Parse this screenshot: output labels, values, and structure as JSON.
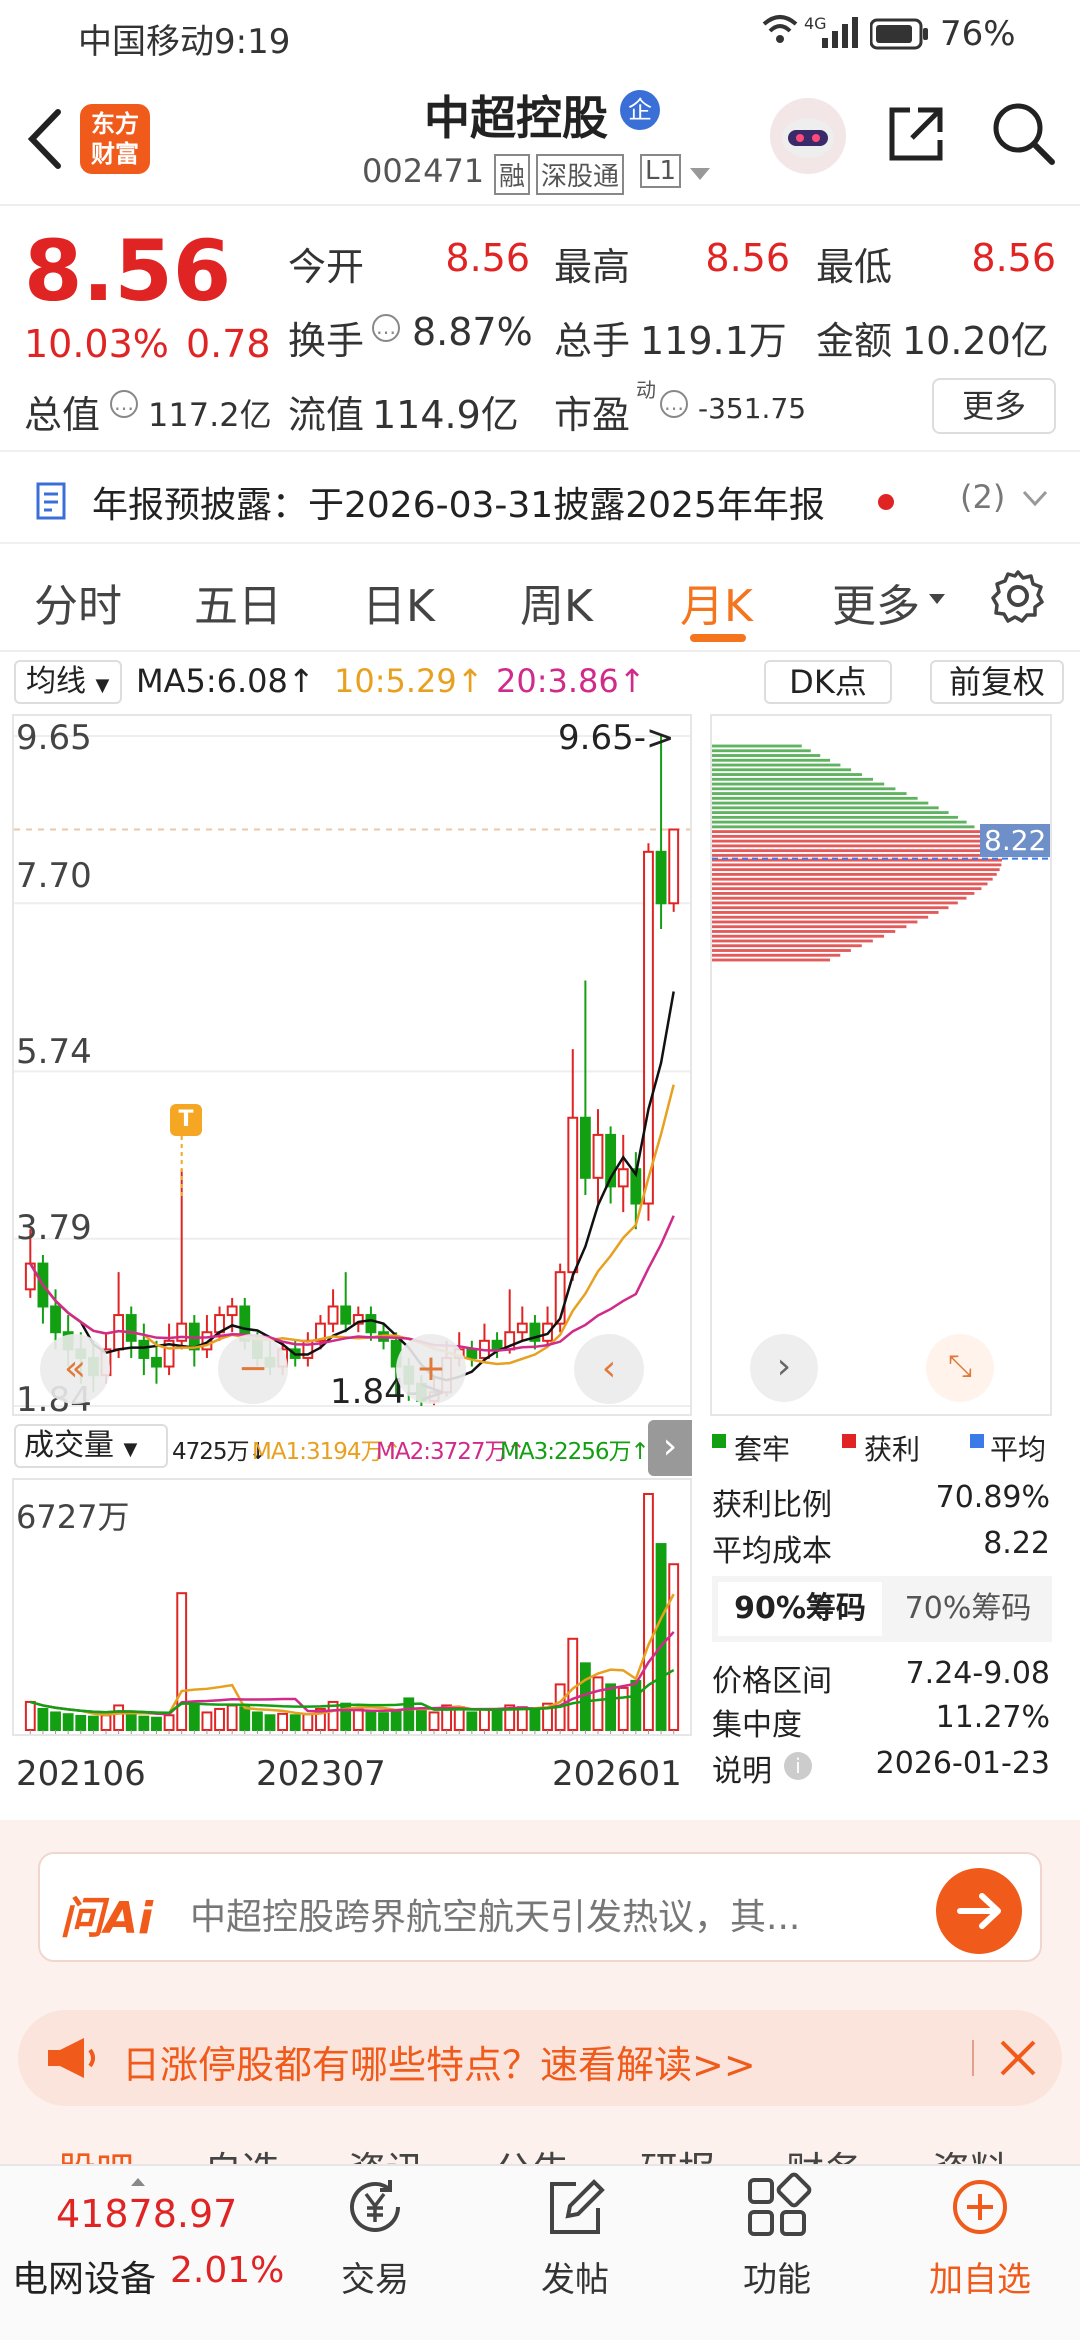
{
  "status_bar": {
    "carrier_time": "中国移动9:19",
    "signal": "4G",
    "battery": "76%"
  },
  "header": {
    "logo": "东方\n财富",
    "stock_name": "中超控股",
    "badge": "企",
    "code": "002471",
    "tags": [
      "融",
      "深股通",
      "L1"
    ]
  },
  "quote": {
    "price": "8.56",
    "change_pct": "10.03%",
    "change": "0.78",
    "open_label": "今开",
    "open": "8.56",
    "high_label": "最高",
    "high": "8.56",
    "low_label": "最低",
    "low": "8.56",
    "turnover_label": "换手",
    "turnover": "8.87%",
    "volume_label": "总手",
    "volume": "119.1万",
    "amount_label": "金额",
    "amount": "10.20亿",
    "mktcap_label": "总值",
    "mktcap": "117.2亿",
    "float_label": "流值",
    "float": "114.9亿",
    "pe_label": "市盈",
    "pe_sup": "动",
    "pe": "-351.75",
    "more_label": "更多"
  },
  "notice": {
    "text": "年报预披露：于2026-03-31披露2025年年报",
    "count": "(2)"
  },
  "tabs": [
    "分时",
    "五日",
    "日K",
    "周K",
    "月K",
    "更多"
  ],
  "active_tab": "月K",
  "ma_bar": {
    "selector": "均线",
    "ma5": "MA5:6.08",
    "ma10": "10:5.29",
    "ma20": "20:3.86",
    "dk": "DK点",
    "fq": "前复权"
  },
  "price_axis": {
    "labels": [
      "9.65",
      "7.70",
      "5.74",
      "3.79",
      "1.84"
    ],
    "max_marker": "9.65->",
    "min_marker": "1.84->",
    "t_marker": "T"
  },
  "chip_panel": {
    "avg_label": "8.22",
    "legend": [
      "套牢",
      "获利",
      "平均"
    ],
    "profit_ratio_label": "获利比例",
    "profit_ratio": "70.89%",
    "avg_cost_label": "平均成本",
    "avg_cost": "8.22",
    "tab90": "90%筹码",
    "tab70": "70%筹码",
    "range_label": "价格区间",
    "range": "7.24-9.08",
    "concentration_label": "集中度",
    "concentration": "11.27%",
    "note_label": "说明",
    "note_date": "2026-01-23"
  },
  "volume_bar": {
    "selector": "成交量",
    "vol": "4725万",
    "ma1": "MA1:3194万",
    "ma2": "MA2:3727万",
    "ma3": "MA3:2256万",
    "max_label": "6727万"
  },
  "x_axis": [
    "202106",
    "202307",
    "202601"
  ],
  "ai_search": {
    "brand": "问Ai",
    "placeholder": "中超控股跨界航空航天引发热议，其..."
  },
  "banner": {
    "text": "日涨停股都有哪些特点？速看解读>>"
  },
  "peek_tabs": [
    "股吧",
    "自选",
    "资讯",
    "公告",
    "研报",
    "财务",
    "资料"
  ],
  "bottom": {
    "index_value": "41878.97",
    "index_name": "电网设备",
    "index_pct": "2.01%",
    "trade": "交易",
    "post": "发帖",
    "func": "功能",
    "add": "加自选"
  },
  "colors": {
    "up": "#e02424",
    "down": "#12a012",
    "accent": "#f5751f"
  },
  "chart_data": {
    "type": "candlestick",
    "price_axis_labels": [
      9.65,
      7.7,
      5.74,
      3.79,
      1.84
    ],
    "candles": [
      [
        3.2,
        3.5,
        3.1,
        3.9
      ],
      [
        3.5,
        3.0,
        2.8,
        3.6
      ],
      [
        3.0,
        2.7,
        2.5,
        3.2
      ],
      [
        2.7,
        2.5,
        2.3,
        2.9
      ],
      [
        2.5,
        2.4,
        2.1,
        2.7
      ],
      [
        2.4,
        2.2,
        2.0,
        2.6
      ],
      [
        2.2,
        2.5,
        2.1,
        2.7
      ],
      [
        2.5,
        2.9,
        2.4,
        3.4
      ],
      [
        2.9,
        2.6,
        2.4,
        3.0
      ],
      [
        2.6,
        2.4,
        2.2,
        2.8
      ],
      [
        2.4,
        2.3,
        2.1,
        2.6
      ],
      [
        2.3,
        2.6,
        2.2,
        2.8
      ],
      [
        2.6,
        2.8,
        2.5,
        4.6
      ],
      [
        2.8,
        2.5,
        2.3,
        2.9
      ],
      [
        2.5,
        2.7,
        2.4,
        2.9
      ],
      [
        2.7,
        2.9,
        2.6,
        3.0
      ],
      [
        2.9,
        3.0,
        2.7,
        3.1
      ],
      [
        3.0,
        2.6,
        2.5,
        3.1
      ],
      [
        2.6,
        2.4,
        2.3,
        2.7
      ],
      [
        2.4,
        2.3,
        2.2,
        2.6
      ],
      [
        2.3,
        2.5,
        2.2,
        2.6
      ],
      [
        2.5,
        2.4,
        2.3,
        2.6
      ],
      [
        2.4,
        2.6,
        2.3,
        2.7
      ],
      [
        2.6,
        2.8,
        2.5,
        2.9
      ],
      [
        2.8,
        3.0,
        2.7,
        3.2
      ],
      [
        3.0,
        2.8,
        2.7,
        3.4
      ],
      [
        2.8,
        2.9,
        2.7,
        3.0
      ],
      [
        2.9,
        2.7,
        2.6,
        3.0
      ],
      [
        2.7,
        2.6,
        2.5,
        2.8
      ],
      [
        2.6,
        2.3,
        1.95,
        2.7
      ],
      [
        2.3,
        2.1,
        1.9,
        2.4
      ],
      [
        2.1,
        1.9,
        1.84,
        2.2
      ],
      [
        1.9,
        2.0,
        1.85,
        2.2
      ],
      [
        2.0,
        2.4,
        1.95,
        2.6
      ],
      [
        2.4,
        2.5,
        2.3,
        2.7
      ],
      [
        2.5,
        2.4,
        2.3,
        2.6
      ],
      [
        2.4,
        2.6,
        2.35,
        2.8
      ],
      [
        2.6,
        2.5,
        2.4,
        2.7
      ],
      [
        2.5,
        2.7,
        2.45,
        3.2
      ],
      [
        2.7,
        2.8,
        2.6,
        3.0
      ],
      [
        2.8,
        2.6,
        2.5,
        2.9
      ],
      [
        2.6,
        2.8,
        2.55,
        3.0
      ],
      [
        2.8,
        3.4,
        2.7,
        3.5
      ],
      [
        3.4,
        5.2,
        3.3,
        6.0
      ],
      [
        5.2,
        4.5,
        4.3,
        6.8
      ],
      [
        4.5,
        5.0,
        4.2,
        5.3
      ],
      [
        5.0,
        4.4,
        4.2,
        5.1
      ],
      [
        4.4,
        4.6,
        4.1,
        5.0
      ],
      [
        4.6,
        4.2,
        3.9,
        4.8
      ],
      [
        4.2,
        8.3,
        4.0,
        8.4
      ],
      [
        8.3,
        7.7,
        7.4,
        9.65
      ],
      [
        7.7,
        8.56,
        7.6,
        8.56
      ]
    ],
    "volumes": [
      800,
      600,
      500,
      450,
      400,
      380,
      420,
      700,
      500,
      380,
      350,
      420,
      3900,
      700,
      500,
      600,
      700,
      650,
      500,
      420,
      460,
      420,
      450,
      600,
      800,
      750,
      600,
      500,
      480,
      520,
      900,
      600,
      500,
      700,
      650,
      500,
      600,
      550,
      700,
      650,
      600,
      750,
      1300,
      2600,
      1900,
      1500,
      1300,
      1200,
      1400,
      6727,
      5300,
      4725
    ],
    "ma_lines": [
      "MA5",
      "MA10",
      "MA20"
    ],
    "x_labels": [
      "202106",
      "202307",
      "202601"
    ]
  }
}
